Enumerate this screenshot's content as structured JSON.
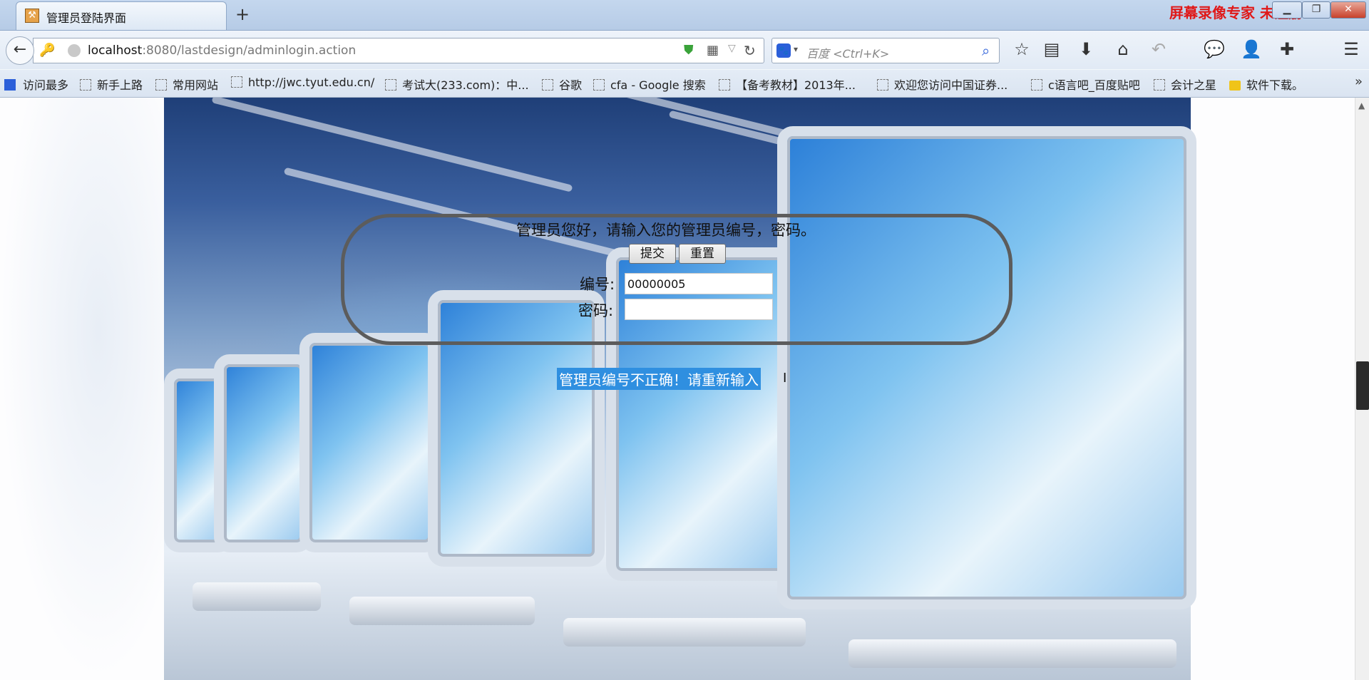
{
  "browser": {
    "tab_title": "管理员登陆界面",
    "new_tab": "+",
    "url_host": "localhost",
    "url_rest": ":8080/lastdesign/adminlogin.action",
    "search_placeholder": "百度 <Ctrl+K>",
    "recorder_watermark": "屏幕录像专家  未注册",
    "icons": [
      "back-icon",
      "key-icon",
      "globe-icon",
      "shield-icon",
      "qr-icon",
      "reload-icon",
      "baidu-icon",
      "search-icon",
      "star-icon",
      "reader-icon",
      "download-icon",
      "home-icon",
      "undo-icon",
      "chat-icon",
      "user-icon",
      "extension-icon",
      "menu-icon"
    ]
  },
  "bookmarks": [
    {
      "label": "访问最多"
    },
    {
      "label": "新手上路"
    },
    {
      "label": "常用网站"
    },
    {
      "label": "http://jwc.tyut.edu.cn/"
    },
    {
      "label": "考试大(233.com)：中..."
    },
    {
      "label": "谷歌"
    },
    {
      "label": "cfa - Google 搜索"
    },
    {
      "label": "【备考教材】2013年..."
    },
    {
      "label": "欢迎您访问中国证券..."
    },
    {
      "label": "c语言吧_百度贴吧"
    },
    {
      "label": "会计之星"
    },
    {
      "label": "软件下载。"
    }
  ],
  "login": {
    "prompt": "管理员您好，请输入您的管理员编号，密码。",
    "submit_label": "提交",
    "reset_label": "重置",
    "id_label": "编号:",
    "id_value": "00000005",
    "pw_label": "密码:",
    "pw_value": "",
    "error_message": "管理员编号不正确！请重新输入"
  },
  "colors": {
    "accent": "#2f8fe0",
    "watermark": "#e01818",
    "frame": "#5c5c5c"
  }
}
